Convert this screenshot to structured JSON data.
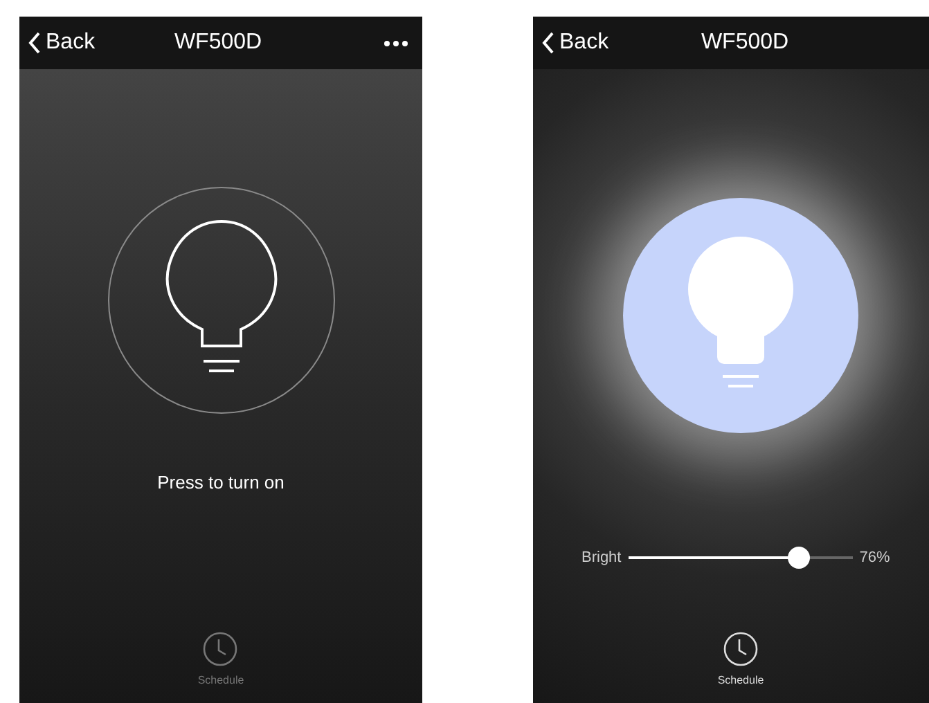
{
  "screens": [
    {
      "back_label": "Back",
      "title": "WF500D",
      "on": false,
      "hint": "Press to turn on",
      "schedule_label": "Schedule"
    },
    {
      "back_label": "Back",
      "title": "WF500D",
      "on": true,
      "slider": {
        "label": "Bright",
        "level": 0.76,
        "reading": "76%"
      },
      "schedule_label": "Schedule"
    }
  ]
}
